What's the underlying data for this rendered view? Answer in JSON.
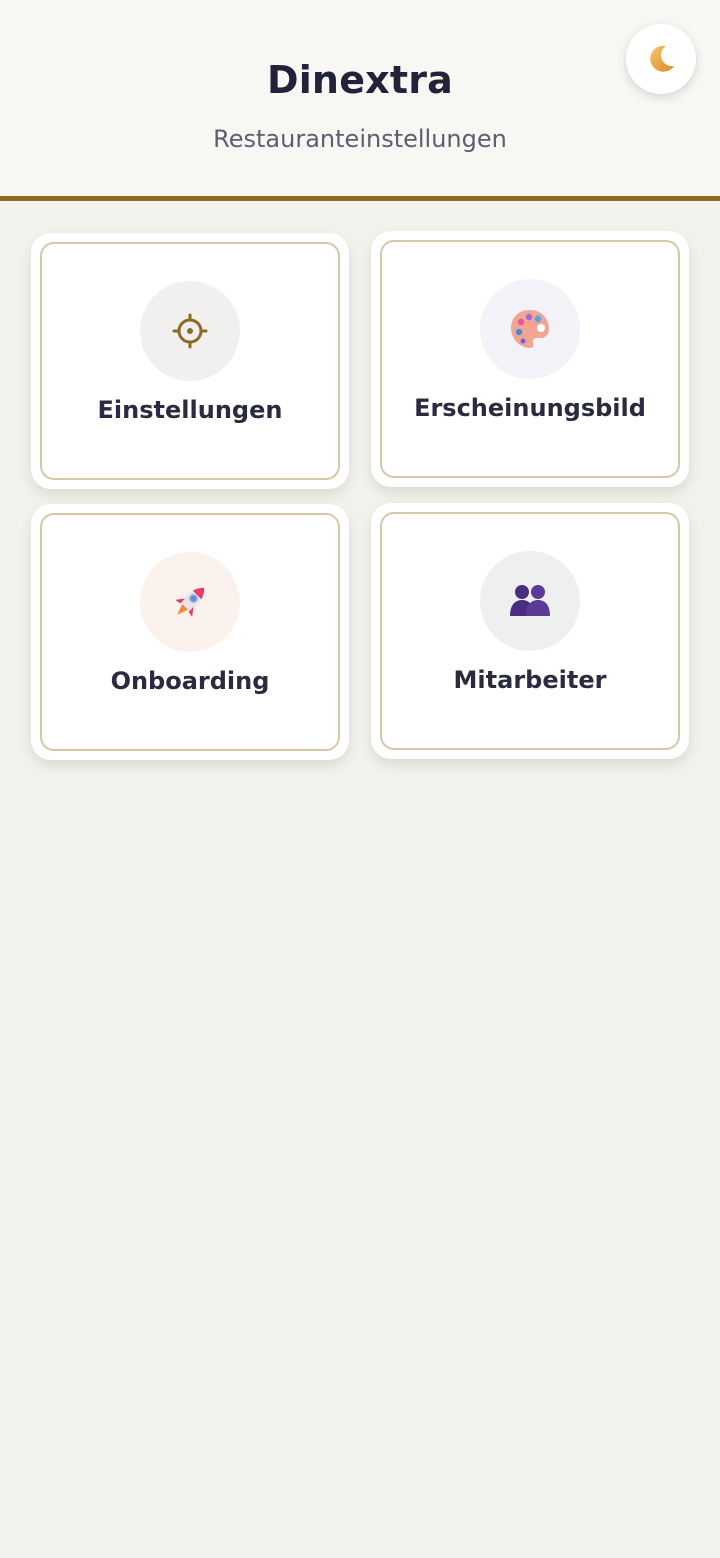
{
  "header": {
    "title": "Dinextra",
    "subtitle": "Restauranteinstellungen",
    "accent_color": "#8e6a25",
    "theme_toggle_icon": "moon-icon"
  },
  "cards": [
    {
      "label": "Einstellungen",
      "icon": "gear-icon",
      "icon_bg": "#f1f0ee"
    },
    {
      "label": "Erscheinungsbild",
      "icon": "palette-icon",
      "icon_bg": "#f3f2f8"
    },
    {
      "label": "Onboarding",
      "icon": "rocket-icon",
      "icon_bg": "#fbf2ee"
    },
    {
      "label": "Mitarbeiter",
      "icon": "users-icon",
      "icon_bg": "#eef0ef"
    }
  ]
}
